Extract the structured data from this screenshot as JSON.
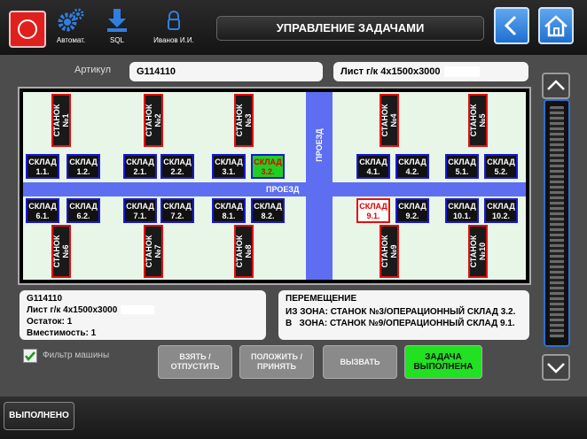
{
  "header": {
    "title": "УПРАВЛЕНИЕ ЗАДАЧАМИ",
    "icons": [
      {
        "name": "gears-icon",
        "label": "Автомат."
      },
      {
        "name": "download-icon",
        "label": "SQL"
      },
      {
        "name": "lock-icon",
        "label": "Иванов И.И."
      }
    ]
  },
  "article": {
    "label": "Артикул",
    "code": "G114110",
    "description": "Лист г/к 4х1500х3000"
  },
  "map": {
    "road_horizontal": "ПРОЕЗД",
    "road_vertical": "ПРОЕЗД",
    "machines_top": [
      "СТАНОК\n№1",
      "СТАНОК\n№2",
      "СТАНОК\n№3",
      "СТАНОК\n№4",
      "СТАНОК\n№5"
    ],
    "machines_bottom": [
      "СТАНОК\n№6",
      "СТАНОК\n№7",
      "СТАНОК\n№8",
      "СТАНОК\n№9",
      "СТАНОК\n№10"
    ],
    "warehouses_top": [
      "СКЛАД\n1.1.",
      "СКЛАД\n1.2.",
      "СКЛАД\n2.1.",
      "СКЛАД\n2.2.",
      "СКЛАД\n3.1.",
      "СКЛАД\n3.2.",
      "СКЛАД\n4.1.",
      "СКЛАД\n4.2.",
      "СКЛАД\n5.1.",
      "СКЛАД\n5.2."
    ],
    "warehouses_bottom": [
      "СКЛАД\n6.1.",
      "СКЛАД\n6.2.",
      "СКЛАД\n7.1.",
      "СКЛАД\n7.2.",
      "СКЛАД\n8.1.",
      "СКЛАД\n8.2.",
      "СКЛАД\n9.1.",
      "СКЛАД\n9.2.",
      "СКЛАД\n10.1.",
      "СКЛАД\n10.2."
    ],
    "highlight_source": "СКЛАД 3.2.",
    "highlight_target": "СКЛАД 9.1."
  },
  "info": {
    "code": "G114110",
    "description": "Лист г/к 4х1500х3000",
    "remainder": "Остаток: 1",
    "capacity": "Вместимость: 1"
  },
  "movement": {
    "title": "ПЕРЕМЕЩЕНИЕ",
    "from": "ИЗ ЗОНА: СТАНОК №3/ОПЕРАЦИОННЫЙ СКЛАД 3.2.",
    "to": "В   ЗОНА: СТАНОК №9/ОПЕРАЦИОННЫЙ СКЛАД 9.1."
  },
  "filter": {
    "label": "Фильтр машины",
    "checked": true
  },
  "actions": {
    "take": "ВЗЯТЬ /\nОТПУСТИТЬ",
    "put": "ПОЛОЖИТЬ /\nПРИНЯТЬ",
    "call": "ВЫЗВАТЬ",
    "complete": "ЗАДАЧА\nВЫПОЛНЕНА"
  },
  "footer": {
    "done": "ВЫПОЛНЕНО"
  },
  "colors": {
    "accent": "#2f7fe0",
    "stop": "#e0201c",
    "complete": "#22e022",
    "road": "#5e6ef0",
    "machine_border": "#e01010",
    "warehouse_border": "#1818d8"
  }
}
